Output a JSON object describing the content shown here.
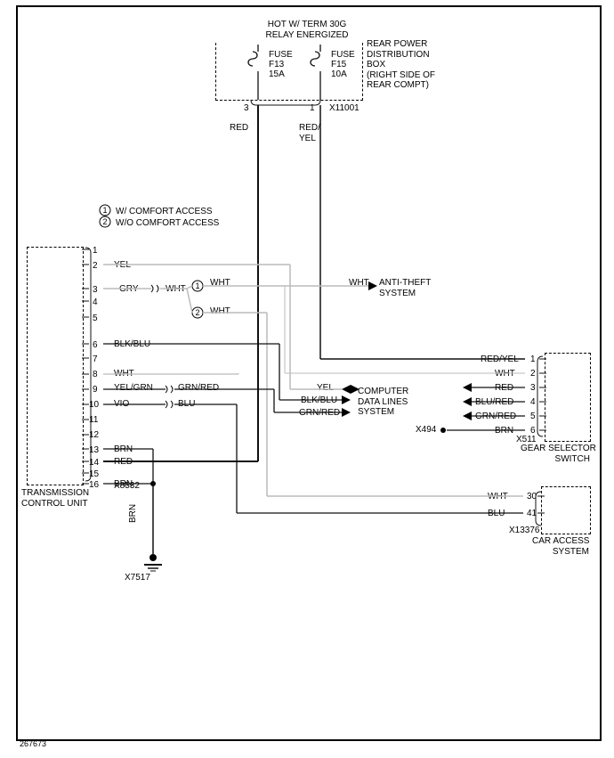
{
  "title": "HOT W/ TERM 30G\nRELAY ENERGIZED",
  "footer_ref": "267673",
  "notes": {
    "note1": {
      "num": "1",
      "text": "W/ COMFORT ACCESS"
    },
    "note2": {
      "num": "2",
      "text": "W/O COMFORT ACCESS"
    }
  },
  "boxes": {
    "tcu": {
      "label": "TRANSMISSION\nCONTROL UNIT",
      "conn": "X8532"
    },
    "rpdb": {
      "label": "REAR POWER\nDISTRIBUTION\nBOX\n(RIGHT SIDE OF\nREAR COMPT)",
      "conn": "X11001"
    },
    "gss": {
      "label": "GEAR SELECTOR\nSWITCH",
      "conn": "X511",
      "conn2": "X494"
    },
    "cas": {
      "label": "CAR ACCESS\nSYSTEM",
      "conn": "X13376"
    }
  },
  "fuses": {
    "f13": {
      "label": "FUSE",
      "name": "F13",
      "amp": "15A"
    },
    "f15": {
      "label": "FUSE",
      "name": "F15",
      "amp": "10A"
    }
  },
  "connector_pins": {
    "tcu": [
      "1",
      "2",
      "3",
      "4",
      "5",
      "6",
      "7",
      "8",
      "9",
      "10",
      "11",
      "12",
      "13",
      "14",
      "15",
      "16"
    ],
    "gss": [
      "1",
      "2",
      "3",
      "4",
      "5",
      "6"
    ],
    "cas": [
      "30",
      "41"
    ],
    "rpdb": [
      "3",
      "1"
    ]
  },
  "wire_labels": {
    "tcu2": "YEL",
    "tcu4_a": "GRY",
    "tcu4_b": "WHT",
    "tcu4_up": "WHT",
    "tcu4_dn": "WHT",
    "tcu6": "BLK/BLU",
    "tcu8": "WHT",
    "tcu9_a": "YEL/GRN",
    "tcu9_b": "GRN/RED",
    "tcu10_a": "VIO",
    "tcu10_b": "BLU",
    "tcu13": "BRN",
    "tcu14": "RED",
    "tcu16": "BRN",
    "gnd": "BRN",
    "f13_out": "RED",
    "f15_out": "RED/\nYEL",
    "gss1": "RED/YEL",
    "gss2": "WHT",
    "gss3": "RED",
    "gss4": "BLU/RED",
    "gss5": "GRN/RED",
    "gss6": "BRN",
    "cas30": "WHT",
    "cas41": "BLU",
    "anti_wht": "WHT",
    "cds_yel": "YEL",
    "cds_blkblu": "BLK/BLU",
    "cds_grnred": "GRN/RED"
  },
  "targets": {
    "anti_theft": "ANTI-THEFT\nSYSTEM",
    "cds": "COMPUTER\nDATA LINES\nSYSTEM"
  },
  "circled": {
    "c1": "1",
    "c2": "2"
  },
  "ground": {
    "ref": "X7517"
  }
}
